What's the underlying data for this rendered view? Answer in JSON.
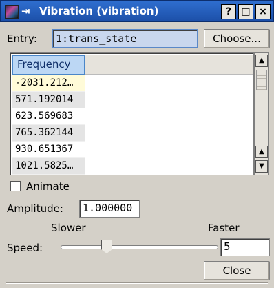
{
  "window": {
    "title": "Vibration (vibration)",
    "help": "?",
    "maximize": "□",
    "close": "×",
    "pin": "⇥"
  },
  "entry": {
    "label": "Entry:",
    "value": "1:trans_state",
    "choose_label": "Choose..."
  },
  "table": {
    "column_header": "Frequency",
    "rows": [
      "-2031.212…",
      "571.192014",
      "623.569683",
      "765.362144",
      "930.651367",
      "1021.5825…"
    ]
  },
  "animate": {
    "label": "Animate",
    "checked": false
  },
  "amplitude": {
    "label": "Amplitude:",
    "value": "1.000000"
  },
  "speed": {
    "slower_label": "Slower",
    "faster_label": "Faster",
    "label": "Speed:",
    "value": "5"
  },
  "close_label": "Close",
  "scrollbar": {
    "up": "▲",
    "down": "▼"
  }
}
